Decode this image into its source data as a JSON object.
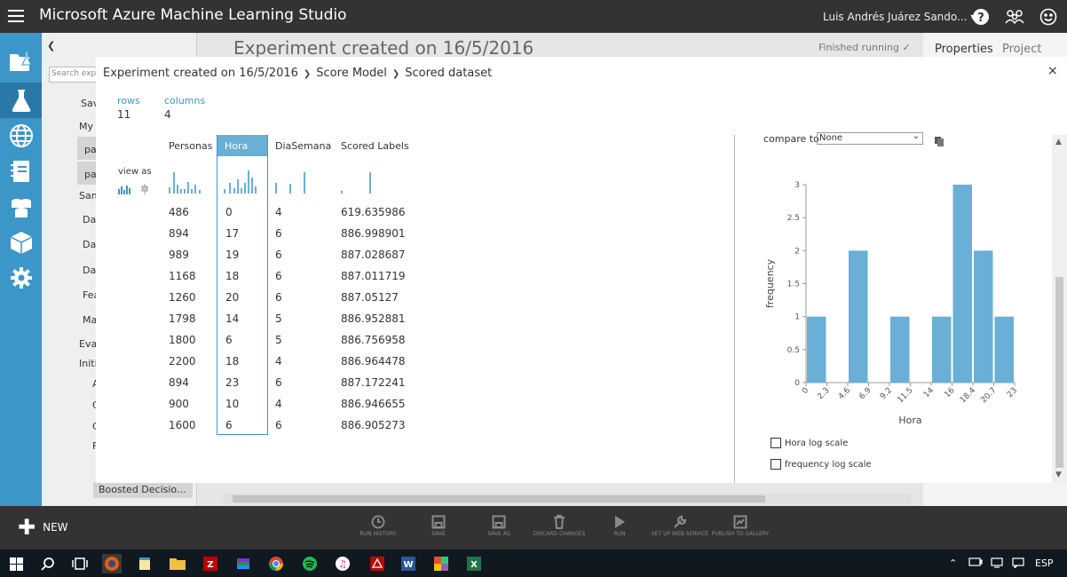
{
  "app": {
    "title": "Microsoft Azure Machine Learning Studio",
    "user": "Luis Andrés Juárez Sando... ",
    "user_caret": "▾"
  },
  "workspace": {
    "experiment_title": "Experiment created on 16/5/2016",
    "status": "Finished running",
    "status_check": "✓",
    "props_tabs": [
      "Properties",
      "Project"
    ],
    "search_placeholder": "Search exp",
    "tree": [
      "Sav",
      "My",
      "pa",
      "pa",
      "Sam",
      "Da",
      "Da",
      "Da",
      "Fea",
      "Ma",
      "Eva",
      "Initi",
      "A",
      "C",
      "C",
      "F"
    ],
    "boosted_label": "Boosted Decisio..."
  },
  "modal": {
    "breadcrumb": [
      "Experiment created on 16/5/2016",
      "Score Model",
      "Scored dataset"
    ],
    "breadcrumb_sep": "❯",
    "close": "×",
    "rows_label": "rows",
    "rows_value": "11",
    "columns_label": "columns",
    "columns_value": "4",
    "view_as": "view as",
    "columns": [
      "Personas",
      "Hora",
      "DiaSemana",
      "Scored Labels"
    ],
    "rows": [
      [
        "486",
        "0",
        "4",
        "619.635986"
      ],
      [
        "894",
        "17",
        "6",
        "886.998901"
      ],
      [
        "989",
        "19",
        "6",
        "887.028687"
      ],
      [
        "1168",
        "18",
        "6",
        "887.011719"
      ],
      [
        "1260",
        "20",
        "6",
        "887.05127"
      ],
      [
        "1798",
        "14",
        "5",
        "886.952881"
      ],
      [
        "1800",
        "6",
        "5",
        "886.756958"
      ],
      [
        "2200",
        "18",
        "4",
        "886.964478"
      ],
      [
        "894",
        "23",
        "6",
        "887.172241"
      ],
      [
        "900",
        "10",
        "4",
        "886.946655"
      ],
      [
        "1600",
        "6",
        "6",
        "886.905273"
      ]
    ],
    "compare_label": "compare to",
    "compare_value": "None",
    "hora_log_scale": "Hora log scale",
    "freq_log_scale": "frequency log scale"
  },
  "chart_data": {
    "type": "bar",
    "xlabel": "Hora",
    "ylabel": "frequency",
    "x_ticks": [
      "0",
      "2.3",
      "4.6",
      "6.9",
      "9.2",
      "11.5",
      "14",
      "16",
      "18.4",
      "20.7",
      "23"
    ],
    "y_ticks": [
      "0",
      "0.5",
      "1",
      "1.5",
      "2",
      "2.5",
      "3"
    ],
    "bins": [
      "0–2.3",
      "2.3–4.6",
      "4.6–6.9",
      "6.9–9.2",
      "9.2–11.5",
      "11.5–14",
      "14–16",
      "16–18.4",
      "18.4–20.7",
      "20.7–23"
    ],
    "values": [
      1,
      0,
      2,
      0,
      1,
      0,
      1,
      3,
      2,
      1
    ],
    "ylim": [
      0,
      3
    ],
    "grid": false,
    "bar_color": "#6aafd6"
  },
  "commands": [
    {
      "label": "RUN HISTORY",
      "icon": "clock-icon"
    },
    {
      "label": "SAVE",
      "icon": "save-icon"
    },
    {
      "label": "SAVE AS",
      "icon": "save-as-icon"
    },
    {
      "label": "DISCARD CHANGES",
      "icon": "trash-icon"
    },
    {
      "label": "RUN",
      "icon": "play-icon"
    },
    {
      "label": "SET UP WEB SERVICE",
      "icon": "wrench-icon"
    },
    {
      "label": "PUBLISH TO GALLERY",
      "icon": "gallery-icon"
    }
  ],
  "new_label": "NEW",
  "taskbar": {
    "lang": "ESP"
  },
  "colors": {
    "accent": "#3d96c8",
    "topbar": "#333333",
    "bar": "#6aafd6"
  }
}
